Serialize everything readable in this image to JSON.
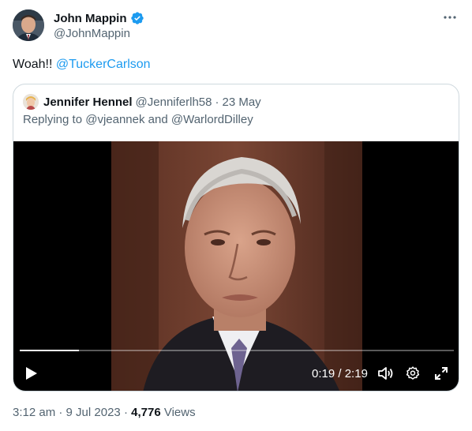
{
  "author": {
    "name": "John Mappin",
    "handle": "@JohnMappin",
    "verified": true
  },
  "tweet": {
    "text": "Woah!!",
    "mention": "@TuckerCarlson"
  },
  "quoted": {
    "name": "Jennifer Hennel",
    "handle": "@Jenniferlh58",
    "separator": "·",
    "date": "23 May",
    "reply_prefix": "Replying to",
    "reply_user1": "@vjeannek",
    "reply_and": "and",
    "reply_user2": "@WarlordDilley"
  },
  "video": {
    "current_time": "0:19",
    "total_time": "2:19",
    "time_separator": "/",
    "progress": 0.137,
    "icons": [
      "play-icon",
      "volume-icon",
      "settings-icon",
      "fullscreen-icon"
    ]
  },
  "footer": {
    "time": "3:12 am",
    "date": "9 Jul 2023",
    "separator": "·",
    "views_count": "4,776",
    "views_label": "Views"
  },
  "colors": {
    "link": "#1d9bf0",
    "secondary_text": "#536471",
    "primary_text": "#0f1419",
    "border": "#cfd9de",
    "verified": "#1d9bf0"
  }
}
